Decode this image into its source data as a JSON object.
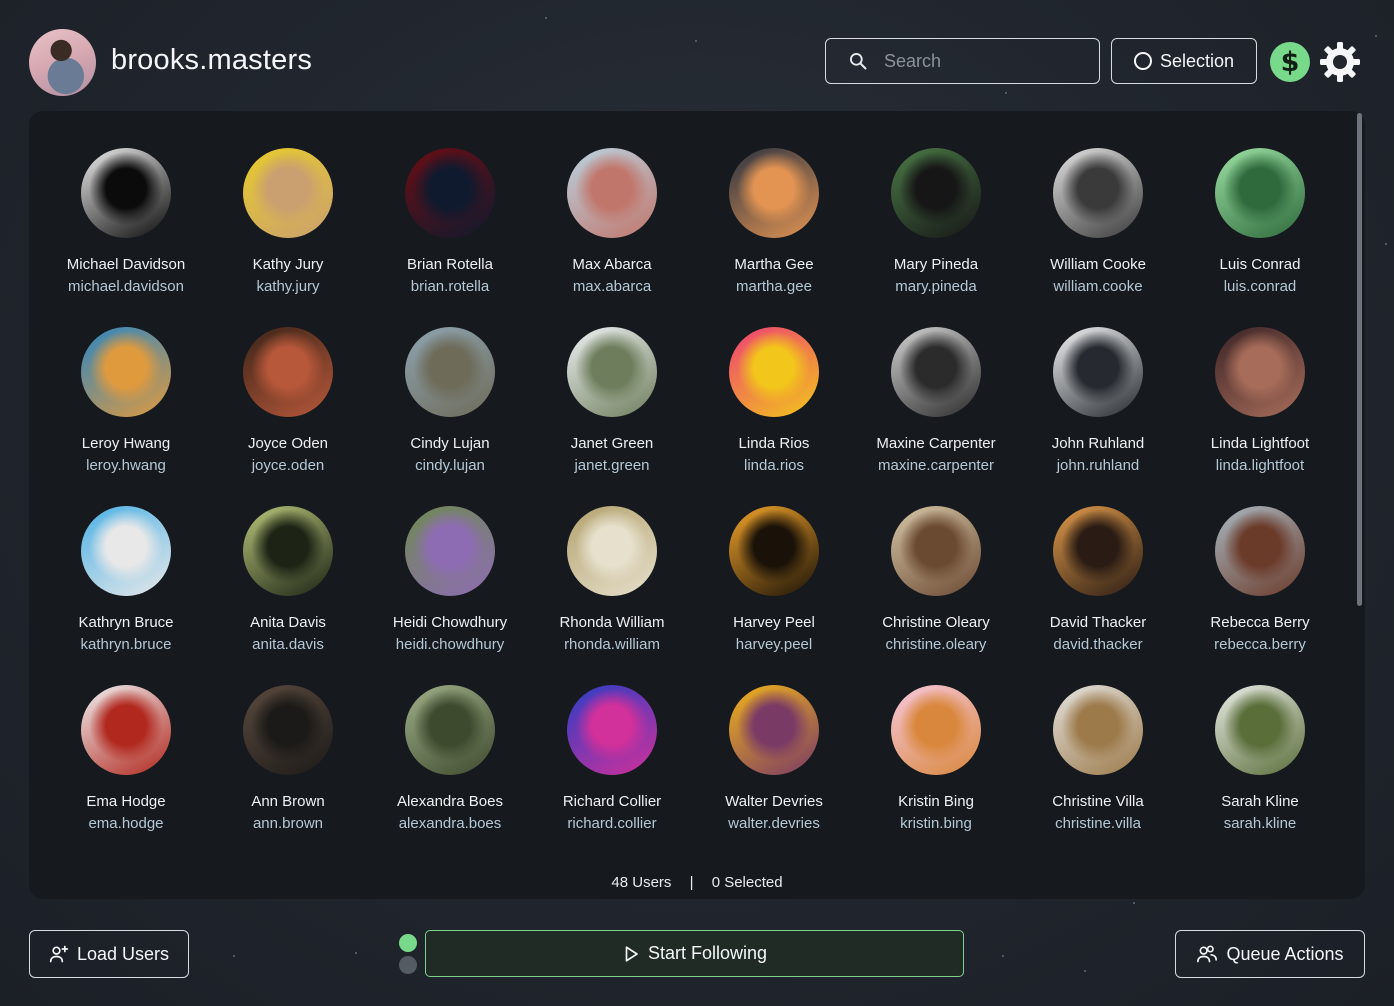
{
  "header": {
    "username": "brooks.masters",
    "search_placeholder": "Search",
    "selection_label": "Selection",
    "dollar_symbol": "$"
  },
  "users": [
    {
      "name": "Michael Davidson",
      "handle": "michael.davidson",
      "c1": "#ececec",
      "c2": "#0b0b0b"
    },
    {
      "name": "Kathy Jury",
      "handle": "kathy.jury",
      "c1": "#e8cc2a",
      "c2": "#caa070"
    },
    {
      "name": "Brian Rotella",
      "handle": "brian.rotella",
      "c1": "#6b0d14",
      "c2": "#101a2e"
    },
    {
      "name": "Max Abarca",
      "handle": "max.abarca",
      "c1": "#b9d3e1",
      "c2": "#c1766b"
    },
    {
      "name": "Martha Gee",
      "handle": "martha.gee",
      "c1": "#2b3342",
      "c2": "#e39452"
    },
    {
      "name": "Mary Pineda",
      "handle": "mary.pineda",
      "c1": "#4b7a47",
      "c2": "#161616"
    },
    {
      "name": "William Cooke",
      "handle": "william.cooke",
      "c1": "#e3e3e3",
      "c2": "#3a3a3a"
    },
    {
      "name": "Luis Conrad",
      "handle": "luis.conrad",
      "c1": "#9ce0a4",
      "c2": "#2f6a3c"
    },
    {
      "name": "Leroy Hwang",
      "handle": "leroy.hwang",
      "c1": "#2c86c2",
      "c2": "#e09a3e"
    },
    {
      "name": "Joyce Oden",
      "handle": "joyce.oden",
      "c1": "#3a2418",
      "c2": "#b8583a"
    },
    {
      "name": "Cindy Lujan",
      "handle": "cindy.lujan",
      "c1": "#8ea5b2",
      "c2": "#6e6b59"
    },
    {
      "name": "Janet Green",
      "handle": "janet.green",
      "c1": "#eef1f3",
      "c2": "#6e7e5c"
    },
    {
      "name": "Linda Rios",
      "handle": "linda.rios",
      "c1": "#ee3f76",
      "c2": "#f2c61a"
    },
    {
      "name": "Maxine Carpenter",
      "handle": "maxine.carpenter",
      "c1": "#d3d3d3",
      "c2": "#2b2b2b"
    },
    {
      "name": "John Ruhland",
      "handle": "john.ruhland",
      "c1": "#f1f3f4",
      "c2": "#262a30"
    },
    {
      "name": "Linda Lightfoot",
      "handle": "linda.lightfoot",
      "c1": "#3a2326",
      "c2": "#a86d5a"
    },
    {
      "name": "Kathryn Bruce",
      "handle": "kathryn.bruce",
      "c1": "#4bb1e6",
      "c2": "#e8e8e8"
    },
    {
      "name": "Anita Davis",
      "handle": "anita.davis",
      "c1": "#b7c57a",
      "c2": "#1d2415"
    },
    {
      "name": "Heidi Chowdhury",
      "handle": "heidi.chowdhury",
      "c1": "#6e8a52",
      "c2": "#8e6cb4"
    },
    {
      "name": "Rhonda William",
      "handle": "rhonda.william",
      "c1": "#b4a26e",
      "c2": "#e6e0cc"
    },
    {
      "name": "Harvey Peel",
      "handle": "harvey.peel",
      "c1": "#f1a32a",
      "c2": "#1a1208"
    },
    {
      "name": "Christine Oleary",
      "handle": "christine.oleary",
      "c1": "#d6c6a8",
      "c2": "#6b4a32"
    },
    {
      "name": "David Thacker",
      "handle": "david.thacker",
      "c1": "#e09a4a",
      "c2": "#2a1c14"
    },
    {
      "name": "Rebecca Berry",
      "handle": "rebecca.berry",
      "c1": "#a9b8c2",
      "c2": "#6b3b2a"
    },
    {
      "name": "Ema Hodge",
      "handle": "ema.hodge",
      "c1": "#efeff0",
      "c2": "#b1281e"
    },
    {
      "name": "Ann Brown",
      "handle": "ann.brown",
      "c1": "#5a4a3e",
      "c2": "#1c1a18"
    },
    {
      "name": "Alexandra Boes",
      "handle": "alexandra.boes",
      "c1": "#9fb089",
      "c2": "#3e4a2e"
    },
    {
      "name": "Richard Collier",
      "handle": "richard.collier",
      "c1": "#2a3ec6",
      "c2": "#d2309a"
    },
    {
      "name": "Walter Devries",
      "handle": "walter.devries",
      "c1": "#f0b41a",
      "c2": "#7a3a66"
    },
    {
      "name": "Kristin Bing",
      "handle": "kristin.bing",
      "c1": "#f7c8de",
      "c2": "#d9873c"
    },
    {
      "name": "Christine Villa",
      "handle": "christine.villa",
      "c1": "#e4e2de",
      "c2": "#9c7a4a"
    },
    {
      "name": "Sarah Kline",
      "handle": "sarah.kline",
      "c1": "#e9ece6",
      "c2": "#5a6e3a"
    }
  ],
  "footer": {
    "users_count": "48 Users",
    "separator": "|",
    "selected_count": "0 Selected"
  },
  "bottom": {
    "load_label": "Load Users",
    "start_label": "Start Following",
    "queue_label": "Queue Actions"
  },
  "colors": {
    "accent_green": "#79d98b",
    "panel_bg": "#16191e",
    "handle_color": "#b4c8d6"
  }
}
